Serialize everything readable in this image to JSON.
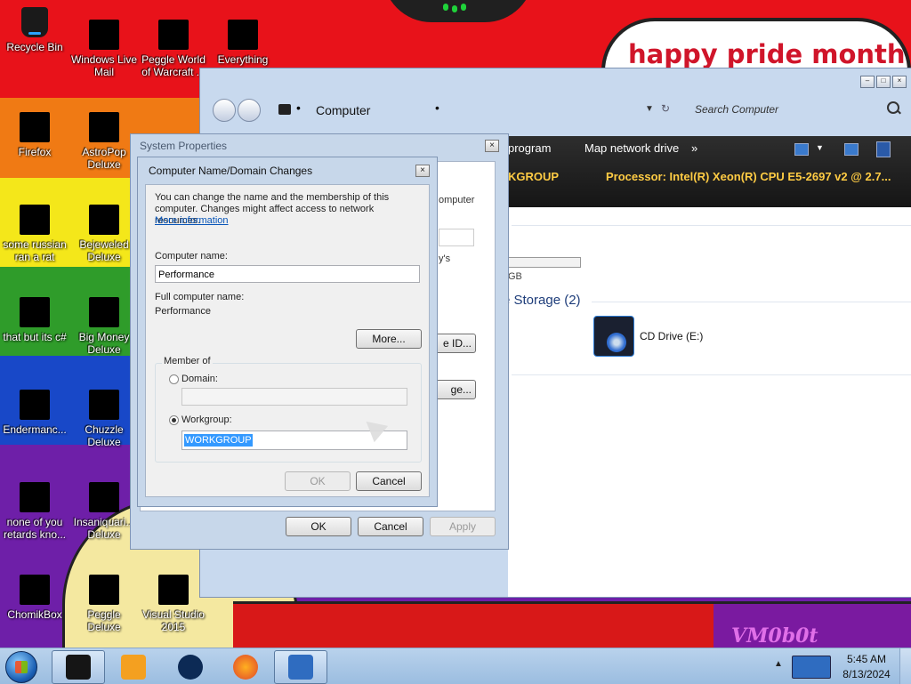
{
  "desktop": {
    "banner_text": "happy pride month",
    "watermark": "VM0b0t",
    "icons": [
      {
        "label": "Recycle Bin",
        "icon": "recycle-bin-icon"
      },
      {
        "label": "Windows Live Mail",
        "icon": "mail-icon"
      },
      {
        "label": "Peggle World of Warcraft ...",
        "icon": "peggle-icon"
      },
      {
        "label": "Everything",
        "icon": "search-app-icon"
      },
      {
        "label": "Firefox",
        "icon": "firefox-icon"
      },
      {
        "label": "AstroPop Deluxe",
        "icon": "game-icon"
      },
      {
        "label": "some russian ran a rat",
        "icon": "app-icon"
      },
      {
        "label": "Bejeweled Deluxe",
        "icon": "gem-icon"
      },
      {
        "label": "that but its c#",
        "icon": "app-icon"
      },
      {
        "label": "Big Money Deluxe",
        "icon": "money-icon"
      },
      {
        "label": "Endermanc...",
        "icon": "app-icon"
      },
      {
        "label": "Chuzzle Deluxe",
        "icon": "game-icon"
      },
      {
        "label": "none of you retards kno...",
        "icon": "app-icon"
      },
      {
        "label": "Insaniquari... Deluxe",
        "icon": "fish-icon"
      },
      {
        "label": "ChomikBox",
        "icon": "hamster-icon"
      },
      {
        "label": "Peggle Deluxe",
        "icon": "peggle-icon"
      },
      {
        "label": "Visual Studio 2015",
        "icon": "visual-studio-icon"
      }
    ]
  },
  "explorer": {
    "address": "Computer",
    "search_placeholder": "Search Computer",
    "cmd_uninstall": "program",
    "cmd_map_drive": "Map network drive",
    "cmd_more": "»",
    "info_workgroup": "KGROUP",
    "info_processor": "Processor: Intel(R) Xeon(R) CPU E5-2697 v2 @ 2.7...",
    "size_unit": "GB",
    "storage_header": "e Storage (2)",
    "cd_drive_label": "CD Drive (E:)"
  },
  "system_properties": {
    "title": "System Properties",
    "tab_partial": "ote",
    "frag_computer": "omputer",
    "frag_ys": "y's",
    "frag_id_btn": "e ID...",
    "frag_change_btn": "ge...",
    "ok": "OK",
    "cancel": "Cancel",
    "apply": "Apply"
  },
  "name_dialog": {
    "title": "Computer Name/Domain Changes",
    "description": "You can change the name and the membership of this computer. Changes might affect access to network resources.",
    "more_info_link": "More information",
    "computer_name_label": "Computer name:",
    "computer_name_value": "Performance",
    "full_name_label": "Full computer name:",
    "full_name_value": "Performance",
    "more_button": "More...",
    "member_of_label": "Member of",
    "domain_label": "Domain:",
    "domain_value": "",
    "workgroup_label": "Workgroup:",
    "workgroup_value": "WORKGROUP",
    "selected_membership": "workgroup",
    "ok": "OK",
    "cancel": "Cancel"
  },
  "taskbar": {
    "time": "5:45 AM",
    "date": "8/13/2024",
    "tray_chevron": "▲"
  },
  "colors": {
    "cmdbar_text": "#ffcc44",
    "link": "#0654b8",
    "selection": "#3399ff"
  }
}
